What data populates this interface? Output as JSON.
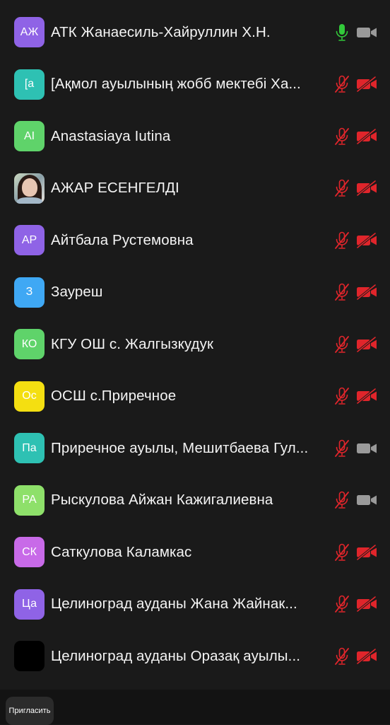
{
  "colors": {
    "background": "#1a1a1a",
    "muted_red": "#e0252b",
    "unmuted_green": "#32c93a",
    "cam_on_gray": "#9a9a9a"
  },
  "participants": [
    {
      "initials": "АЖ",
      "name": "АТК Жанаесиль-Хайруллин Х.Н.",
      "avatar_color": "#8f63e6",
      "avatar_type": "initials",
      "mic": "on",
      "cam": "on"
    },
    {
      "initials": "[а",
      "name": "[Ақмол ауылының жобб мектебі Ха...",
      "avatar_color": "#2ec1b3",
      "avatar_type": "initials",
      "mic": "muted",
      "cam": "off"
    },
    {
      "initials": "AI",
      "name": "Anastasiaya Iutina",
      "avatar_color": "#5fd36a",
      "avatar_type": "initials",
      "mic": "muted",
      "cam": "off"
    },
    {
      "initials": "",
      "name": "АЖАР ЕСЕНГЕЛДІ",
      "avatar_color": "#6b5a52",
      "avatar_type": "photo",
      "mic": "muted",
      "cam": "off"
    },
    {
      "initials": "АР",
      "name": "Айтбала Рустемовна",
      "avatar_color": "#8f63e6",
      "avatar_type": "initials",
      "mic": "muted",
      "cam": "off"
    },
    {
      "initials": "З",
      "name": "Зауреш",
      "avatar_color": "#3fa8f4",
      "avatar_type": "initials",
      "mic": "muted",
      "cam": "off"
    },
    {
      "initials": "КО",
      "name": "КГУ ОШ с.  Жалгызкудук",
      "avatar_color": "#5fd36a",
      "avatar_type": "initials",
      "mic": "muted",
      "cam": "off"
    },
    {
      "initials": "Ос",
      "name": "ОСШ с.Приречное",
      "avatar_color": "#f4df11",
      "avatar_type": "initials",
      "mic": "muted",
      "cam": "off"
    },
    {
      "initials": "Па",
      "name": "Приречное ауылы, Мешитбаева Гул...",
      "avatar_color": "#2ec1b3",
      "avatar_type": "initials",
      "mic": "muted",
      "cam": "on"
    },
    {
      "initials": "РА",
      "name": "Рыскулова Айжан Кажигалиевна",
      "avatar_color": "#8ee06a",
      "avatar_type": "initials",
      "mic": "muted",
      "cam": "on"
    },
    {
      "initials": "СК",
      "name": "Саткулова Каламкас",
      "avatar_color": "#c86ae8",
      "avatar_type": "initials",
      "mic": "muted",
      "cam": "off"
    },
    {
      "initials": "Ца",
      "name": "Целиноград ауданы Жана Жайнак...",
      "avatar_color": "#8f63e6",
      "avatar_type": "initials",
      "mic": "muted",
      "cam": "off"
    },
    {
      "initials": "",
      "name": "Целиноград ауданы Оразақ ауылы...",
      "avatar_color": "#000000",
      "avatar_type": "blank",
      "mic": "muted",
      "cam": "off"
    }
  ],
  "bottom_bar": {
    "invite_label": "Пригласить"
  }
}
